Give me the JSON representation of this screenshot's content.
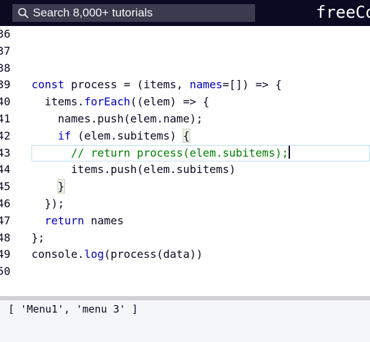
{
  "header": {
    "search_placeholder": "Search 8,000+ tutorials",
    "logo_text": "freeCodeCamp"
  },
  "editor": {
    "lines": [
      {
        "num": "36",
        "segments": []
      },
      {
        "num": "37",
        "segments": []
      },
      {
        "num": "38",
        "segments": []
      },
      {
        "num": "39",
        "segments": [
          {
            "t": "const",
            "c": "kw"
          },
          {
            "t": " process = (items, ",
            "c": ""
          },
          {
            "t": "names",
            "c": "kw"
          },
          {
            "t": "=[]) => {",
            "c": ""
          }
        ]
      },
      {
        "num": "40",
        "segments": [
          {
            "t": "  items.",
            "c": ""
          },
          {
            "t": "forEach",
            "c": "fn"
          },
          {
            "t": "((elem) => {",
            "c": ""
          }
        ]
      },
      {
        "num": "41",
        "segments": [
          {
            "t": "    names.push(elem.name);",
            "c": ""
          }
        ]
      },
      {
        "num": "42",
        "segments": [
          {
            "t": "    ",
            "c": ""
          },
          {
            "t": "if",
            "c": "kw"
          },
          {
            "t": " (elem.subitems) ",
            "c": ""
          },
          {
            "t": "{",
            "c": "bracket"
          }
        ]
      },
      {
        "num": "43",
        "segments": [
          {
            "t": "      ",
            "c": ""
          },
          {
            "t": "// return process(elem.subitems);",
            "c": "cm"
          }
        ],
        "active": true
      },
      {
        "num": "44",
        "segments": [
          {
            "t": "      items.push(elem.subitems)",
            "c": ""
          }
        ]
      },
      {
        "num": "45",
        "segments": [
          {
            "t": "    ",
            "c": ""
          },
          {
            "t": "}",
            "c": "bracket"
          }
        ]
      },
      {
        "num": "46",
        "segments": [
          {
            "t": "  });",
            "c": ""
          }
        ]
      },
      {
        "num": "47",
        "segments": [
          {
            "t": "  ",
            "c": ""
          },
          {
            "t": "return",
            "c": "kw"
          },
          {
            "t": " names",
            "c": ""
          }
        ]
      },
      {
        "num": "48",
        "segments": [
          {
            "t": "};",
            "c": ""
          }
        ]
      },
      {
        "num": "49",
        "segments": [
          {
            "t": "console.",
            "c": ""
          },
          {
            "t": "log",
            "c": "fn"
          },
          {
            "t": "(process(data))",
            "c": ""
          }
        ]
      },
      {
        "num": "50",
        "segments": []
      }
    ]
  },
  "console": {
    "output": "[ 'Menu1', 'menu 3' ]"
  },
  "colors": {
    "header_bg": "#0a0a23",
    "keyword": "#0000c0",
    "comment": "#008000"
  }
}
